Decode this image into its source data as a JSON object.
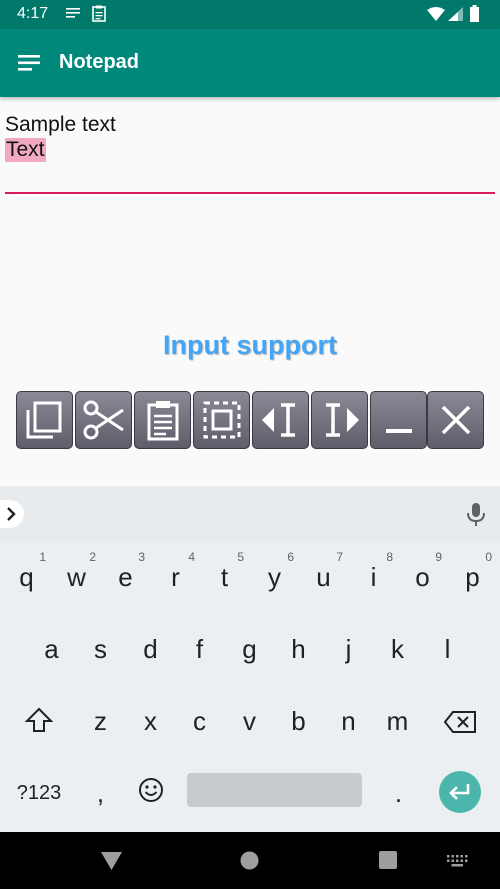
{
  "status_bar": {
    "time": "4:17",
    "notification_icons": [
      "list-icon",
      "clipboard-icon"
    ],
    "system_icons": [
      "wifi-icon",
      "signal-icon",
      "battery-icon"
    ]
  },
  "app_bar": {
    "title": "Notepad",
    "background_color": "#00897b"
  },
  "editor": {
    "line1": "Sample text",
    "line2_selected": "Text",
    "underline_color": "#d81b60",
    "selection_color": "#f2a8bf"
  },
  "input_support": {
    "title": "Input support",
    "color": "#42a5f5",
    "tools": [
      "copy-icon",
      "cut-icon",
      "paste-icon",
      "select-all-icon",
      "cursor-left-icon",
      "cursor-right-icon",
      "space-icon",
      "close-icon"
    ]
  },
  "keyboard": {
    "row1": [
      {
        "key": "q",
        "hint": "1"
      },
      {
        "key": "w",
        "hint": "2"
      },
      {
        "key": "e",
        "hint": "3"
      },
      {
        "key": "r",
        "hint": "4"
      },
      {
        "key": "t",
        "hint": "5"
      },
      {
        "key": "y",
        "hint": "6"
      },
      {
        "key": "u",
        "hint": "7"
      },
      {
        "key": "i",
        "hint": "8"
      },
      {
        "key": "o",
        "hint": "9"
      },
      {
        "key": "p",
        "hint": "0"
      }
    ],
    "row2": [
      "a",
      "s",
      "d",
      "f",
      "g",
      "h",
      "j",
      "k",
      "l"
    ],
    "row3": [
      "z",
      "x",
      "c",
      "v",
      "b",
      "n",
      "m"
    ],
    "symbols_label": "?123",
    "comma": ",",
    "period": ".",
    "accent_color": "#4db6ac"
  }
}
